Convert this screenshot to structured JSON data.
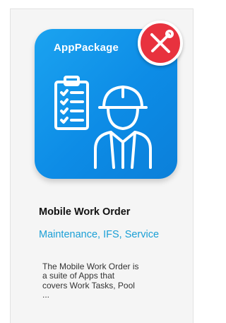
{
  "card": {
    "icon_label": "AppPackage",
    "icon_name": "construction-worker-checklist-icon",
    "badge_icon_name": "tools-icon",
    "title": "Mobile Work Order",
    "tags": "Maintenance, IFS, Service",
    "description_lines": [
      "The Mobile Work Order is",
      "a suite of Apps that",
      "covers Work Tasks, Pool",
      "..."
    ]
  },
  "colors": {
    "tile_blue": "#0d8ce6",
    "badge_red": "#e8323e",
    "tag_blue": "#1a9fd6"
  }
}
